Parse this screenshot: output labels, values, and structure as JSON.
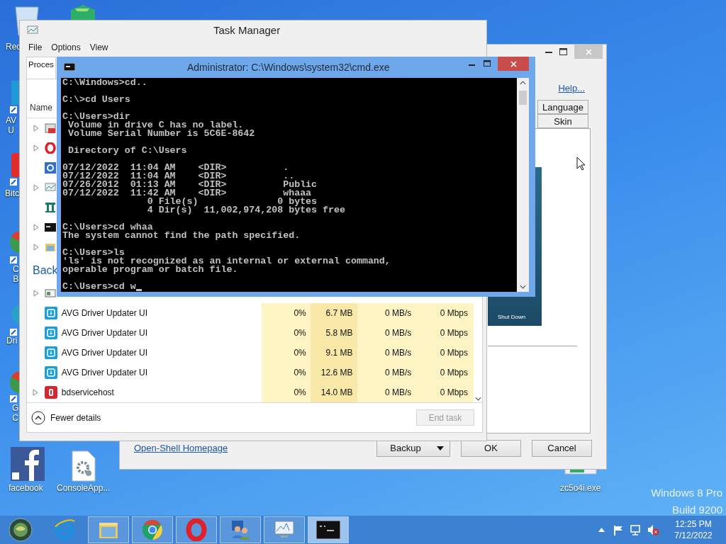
{
  "desktop_icons": [
    {
      "lines": [
        "Rec"
      ]
    },
    {
      "lines": [
        "AV",
        "U"
      ]
    },
    {
      "lines": [
        "Bitc"
      ]
    },
    {
      "lines": [
        "C",
        "B"
      ]
    },
    {
      "lines": [
        "Dri"
      ]
    },
    {
      "lines": [
        "G",
        "C"
      ]
    },
    {
      "lines": [
        "facebook"
      ]
    },
    {
      "lines": [
        "ConsoleApp..."
      ]
    },
    {
      "lines": [
        "zc5o4i.exe"
      ]
    }
  ],
  "open_shell": {
    "help": "Help...",
    "tabs": [
      {
        "label": "Language",
        "selected": false
      },
      {
        "label": "Skin",
        "selected": false
      }
    ],
    "preview_button": "Shut Down",
    "homepage": "Open-Shell Homepage",
    "buttons": [
      {
        "label": "Backup",
        "kind": "dropdown"
      },
      {
        "label": "OK",
        "kind": "plain"
      },
      {
        "label": "Cancel",
        "kind": "plain"
      }
    ]
  },
  "task_manager": {
    "title": "Task Manager",
    "menu": [
      "File",
      "Options",
      "View"
    ],
    "tabs": [
      {
        "label": "Proces",
        "selected": true
      }
    ],
    "name_column": "Name",
    "app_rows": [
      {
        "expandable": true
      },
      {
        "expandable": true
      },
      {
        "expandable": false
      },
      {
        "expandable": true
      },
      {
        "expandable": false
      },
      {
        "expandable": true
      },
      {
        "expandable": true
      }
    ],
    "group": "Back",
    "background_rows": [
      {
        "expandable": true
      },
      {
        "expandable": false,
        "name": "AVG Driver Updater UI",
        "cpu": "0%",
        "memory": "6.7 MB",
        "disk": "0 MB/s",
        "network": "0 Mbps"
      },
      {
        "expandable": false,
        "name": "AVG Driver Updater UI",
        "cpu": "0%",
        "memory": "5.8 MB",
        "disk": "0 MB/s",
        "network": "0 Mbps"
      },
      {
        "expandable": false,
        "name": "AVG Driver Updater UI",
        "cpu": "0%",
        "memory": "9.1 MB",
        "disk": "0 MB/s",
        "network": "0 Mbps"
      },
      {
        "expandable": false,
        "name": "AVG Driver Updater UI",
        "cpu": "0%",
        "memory": "12.6 MB",
        "disk": "0 MB/s",
        "network": "0 Mbps"
      },
      {
        "expandable": true,
        "name": "bdservicehost",
        "cpu": "0%",
        "memory": "14.0 MB",
        "disk": "0 MB/s",
        "network": "0 Mbps"
      }
    ],
    "fewer_details": "Fewer details",
    "end_task": {
      "label": "End task",
      "disabled": true
    }
  },
  "cmd": {
    "title": "Administrator: C:\\Windows\\system32\\cmd.exe",
    "blocks": [
      [
        "C:\\Windows>cd.."
      ],
      [
        "C:\\>cd Users"
      ],
      [
        "C:\\Users>dir",
        " Volume in drive C has no label.",
        " Volume Serial Number is 5C6E-8642"
      ],
      [
        " Directory of C:\\Users"
      ],
      [
        "07/12/2022  11:04 AM    <DIR>          .",
        "07/12/2022  11:04 AM    <DIR>          ..",
        "07/26/2012  01:13 AM    <DIR>          Public",
        "07/12/2022  11:42 AM    <DIR>          whaaa",
        "               0 File(s)              0 bytes",
        "               4 Dir(s)  11,002,974,208 bytes free"
      ],
      [
        "C:\\Users>cd whaa",
        "The system cannot find the path specified."
      ],
      [
        "C:\\Users>ls",
        "'ls' is not recognized as an internal or external command,",
        "operable program or batch file."
      ]
    ],
    "prompt": "C:\\Users>cd w"
  },
  "taskbar": {
    "apps": [
      {
        "running": false,
        "selected": false
      },
      {
        "running": true,
        "selected": false
      },
      {
        "running": true,
        "selected": false
      },
      {
        "running": true,
        "selected": false
      },
      {
        "running": true,
        "selected": false
      },
      {
        "running": true,
        "selected": false
      },
      {
        "running": true,
        "selected": true
      }
    ],
    "time": "12:25 PM",
    "date": "7/12/2022"
  },
  "edition": [
    "Windows 8 Pro",
    "Build 9200"
  ]
}
